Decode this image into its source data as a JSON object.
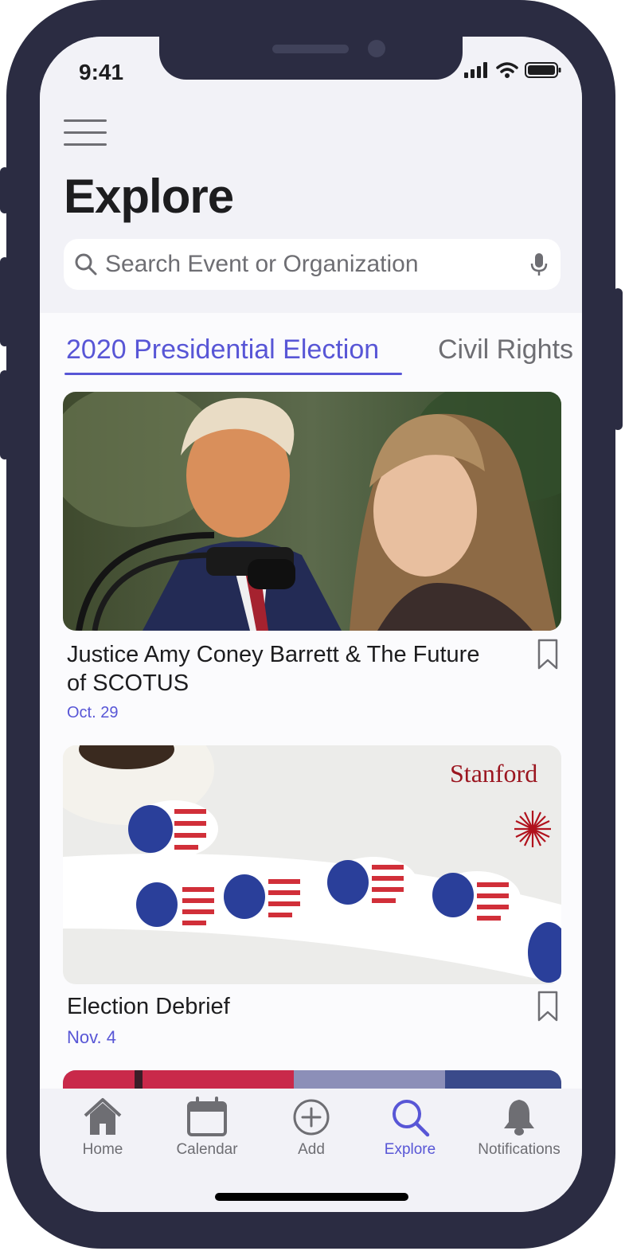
{
  "status_bar": {
    "time": "9:41"
  },
  "header": {
    "title": "Explore"
  },
  "search": {
    "placeholder": "Search Event or Organization"
  },
  "topic_tabs": [
    {
      "label": "2020 Presidential Election",
      "active": true
    },
    {
      "label": "Civil Rights",
      "active": false
    }
  ],
  "events": [
    {
      "title": "Justice Amy Coney Barrett & The Future of SCOTUS",
      "date": "Oct. 29"
    },
    {
      "title": "Election Debrief",
      "date": "Nov. 4",
      "image_text": "Stanford"
    }
  ],
  "tab_bar": [
    {
      "label": "Home",
      "icon": "home-icon"
    },
    {
      "label": "Calendar",
      "icon": "calendar-icon"
    },
    {
      "label": "Add",
      "icon": "add-icon"
    },
    {
      "label": "Explore",
      "icon": "search-icon",
      "active": true
    },
    {
      "label": "Notifications",
      "icon": "bell-icon"
    }
  ],
  "colors": {
    "accent": "#5856d6",
    "frame": "#2b2c42",
    "background": "#f2f2f7"
  }
}
